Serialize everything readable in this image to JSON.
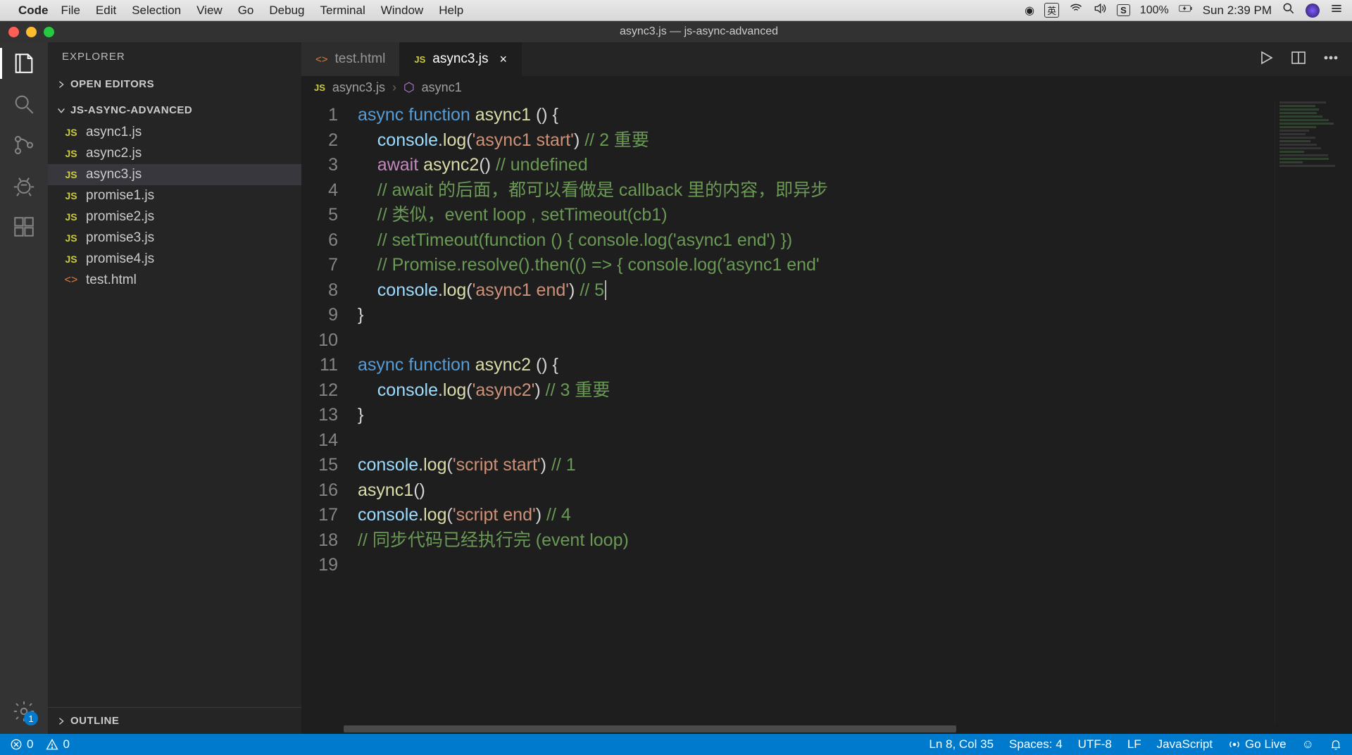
{
  "menubar": {
    "app": "Code",
    "items": [
      "File",
      "Edit",
      "Selection",
      "View",
      "Go",
      "Debug",
      "Terminal",
      "Window",
      "Help"
    ],
    "battery": "100%",
    "clock": "Sun 2:39 PM"
  },
  "titlebar": {
    "title": "async3.js — js-async-advanced"
  },
  "activitybar": {
    "settings_badge": "1"
  },
  "sidebar": {
    "head": "EXPLORER",
    "open_editors": "OPEN EDITORS",
    "project": "JS-ASYNC-ADVANCED",
    "files": [
      {
        "icon": "JS",
        "name": "async1.js"
      },
      {
        "icon": "JS",
        "name": "async2.js"
      },
      {
        "icon": "JS",
        "name": "async3.js",
        "active": true
      },
      {
        "icon": "JS",
        "name": "promise1.js"
      },
      {
        "icon": "JS",
        "name": "promise2.js"
      },
      {
        "icon": "JS",
        "name": "promise3.js"
      },
      {
        "icon": "JS",
        "name": "promise4.js"
      },
      {
        "icon": "<>",
        "name": "test.html"
      }
    ],
    "outline": "OUTLINE"
  },
  "tabs": {
    "items": [
      {
        "icon": "<>",
        "label": "test.html"
      },
      {
        "icon": "JS",
        "label": "async3.js",
        "active": true
      }
    ]
  },
  "breadcrumb": {
    "file": "async3.js",
    "symbol": "async1"
  },
  "code": {
    "lines": [
      [
        {
          "t": "async ",
          "c": "tok-kw"
        },
        {
          "t": "function ",
          "c": "tok-kw"
        },
        {
          "t": "async1 ",
          "c": "tok-name"
        },
        {
          "t": "() {",
          "c": "tok-punc"
        }
      ],
      [
        {
          "t": "    "
        },
        {
          "t": "console",
          "c": "tok-obj"
        },
        {
          "t": ".",
          "c": "tok-punc"
        },
        {
          "t": "log",
          "c": "tok-fn"
        },
        {
          "t": "(",
          "c": "tok-punc"
        },
        {
          "t": "'async1 start'",
          "c": "tok-str"
        },
        {
          "t": ") ",
          "c": "tok-punc"
        },
        {
          "t": "// 2 重要",
          "c": "tok-com"
        }
      ],
      [
        {
          "t": "    "
        },
        {
          "t": "await ",
          "c": "tok-await"
        },
        {
          "t": "async2",
          "c": "tok-fn"
        },
        {
          "t": "() ",
          "c": "tok-punc"
        },
        {
          "t": "// undefined",
          "c": "tok-com"
        }
      ],
      [
        {
          "t": "    "
        },
        {
          "t": "// await 的后面，都可以看做是 callback 里的内容，即异步",
          "c": "tok-com"
        }
      ],
      [
        {
          "t": "    "
        },
        {
          "t": "// 类似，event loop , setTimeout(cb1)",
          "c": "tok-com"
        }
      ],
      [
        {
          "t": "    "
        },
        {
          "t": "// setTimeout(function () { console.log('async1 end') })",
          "c": "tok-com"
        }
      ],
      [
        {
          "t": "    "
        },
        {
          "t": "// Promise.resolve().then(() => { console.log('async1 end'",
          "c": "tok-com"
        }
      ],
      [
        {
          "t": "    "
        },
        {
          "t": "console",
          "c": "tok-obj"
        },
        {
          "t": ".",
          "c": "tok-punc"
        },
        {
          "t": "log",
          "c": "tok-fn"
        },
        {
          "t": "(",
          "c": "tok-punc"
        },
        {
          "t": "'async1 end'",
          "c": "tok-str"
        },
        {
          "t": ") ",
          "c": "tok-punc"
        },
        {
          "t": "// 5",
          "c": "tok-com"
        },
        {
          "cursor": true
        }
      ],
      [
        {
          "t": "}",
          "c": "tok-punc"
        }
      ],
      [
        {
          "t": ""
        }
      ],
      [
        {
          "t": "async ",
          "c": "tok-kw"
        },
        {
          "t": "function ",
          "c": "tok-kw"
        },
        {
          "t": "async2 ",
          "c": "tok-name"
        },
        {
          "t": "() {",
          "c": "tok-punc"
        }
      ],
      [
        {
          "t": "    "
        },
        {
          "t": "console",
          "c": "tok-obj"
        },
        {
          "t": ".",
          "c": "tok-punc"
        },
        {
          "t": "log",
          "c": "tok-fn"
        },
        {
          "t": "(",
          "c": "tok-punc"
        },
        {
          "t": "'async2'",
          "c": "tok-str"
        },
        {
          "t": ") ",
          "c": "tok-punc"
        },
        {
          "t": "// 3 重要",
          "c": "tok-com"
        }
      ],
      [
        {
          "t": "}",
          "c": "tok-punc"
        }
      ],
      [
        {
          "t": ""
        }
      ],
      [
        {
          "t": "console",
          "c": "tok-obj"
        },
        {
          "t": ".",
          "c": "tok-punc"
        },
        {
          "t": "log",
          "c": "tok-fn"
        },
        {
          "t": "(",
          "c": "tok-punc"
        },
        {
          "t": "'script start'",
          "c": "tok-str"
        },
        {
          "t": ") ",
          "c": "tok-punc"
        },
        {
          "t": "// 1",
          "c": "tok-com"
        }
      ],
      [
        {
          "t": "async1",
          "c": "tok-fn"
        },
        {
          "t": "()",
          "c": "tok-punc"
        }
      ],
      [
        {
          "t": "console",
          "c": "tok-obj"
        },
        {
          "t": ".",
          "c": "tok-punc"
        },
        {
          "t": "log",
          "c": "tok-fn"
        },
        {
          "t": "(",
          "c": "tok-punc"
        },
        {
          "t": "'script end'",
          "c": "tok-str"
        },
        {
          "t": ") ",
          "c": "tok-punc"
        },
        {
          "t": "// 4",
          "c": "tok-com"
        }
      ],
      [
        {
          "t": "// 同步代码已经执行完 (event loop)",
          "c": "tok-com"
        }
      ],
      [
        {
          "t": ""
        }
      ]
    ]
  },
  "statusbar": {
    "errors": "0",
    "warnings": "0",
    "line_col": "Ln 8, Col 35",
    "spaces": "Spaces: 4",
    "encoding": "UTF-8",
    "eol": "LF",
    "lang": "JavaScript",
    "golive": "Go Live",
    "feedback": "☺"
  }
}
